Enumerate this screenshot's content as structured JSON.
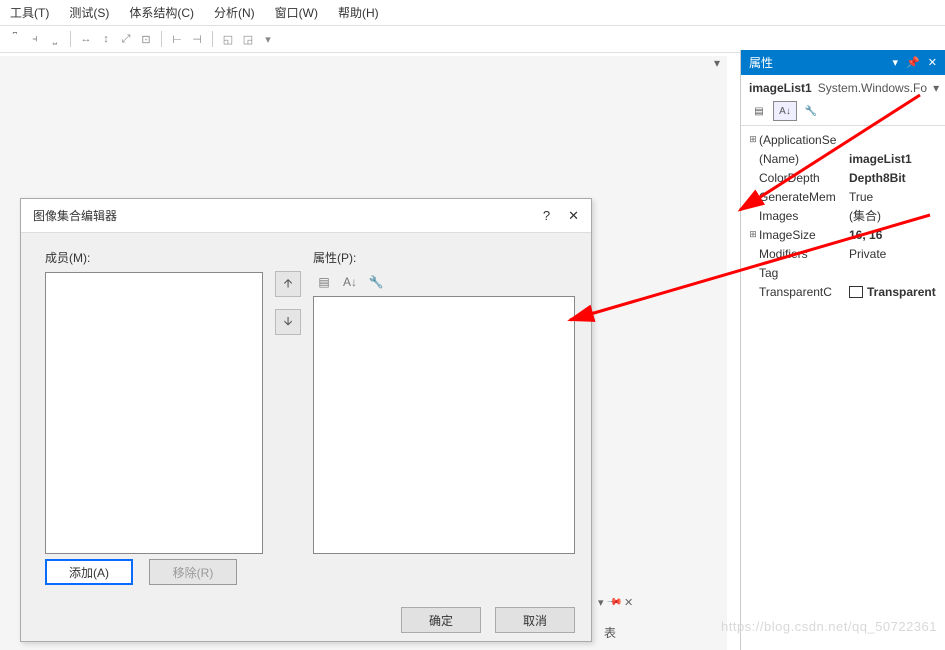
{
  "menu": {
    "tools": "工具(T)",
    "test": "测试(S)",
    "structure": "体系结构(C)",
    "analyze": "分析(N)",
    "window": "窗口(W)",
    "help": "帮助(H)"
  },
  "dialog": {
    "title": "图像集合编辑器",
    "members_label": "成员(M):",
    "props_label": "属性(P):",
    "add": "添加(A)",
    "remove": "移除(R)",
    "ok": "确定",
    "cancel": "取消",
    "help_icon": "?",
    "close_icon": "✕"
  },
  "panel": {
    "title": "属性",
    "object_name": "imageList1",
    "object_type": "System.Windows.Fo",
    "rows": {
      "app": "(ApplicationSe",
      "name_k": "(Name)",
      "name_v": "imageList1",
      "color_k": "ColorDepth",
      "color_v": "Depth8Bit",
      "gen_k": "GenerateMem",
      "gen_v": "True",
      "img_k": "Images",
      "img_v": "(集合)",
      "size_k": "ImageSize",
      "size_v": "16, 16",
      "mod_k": "Modifiers",
      "mod_v": "Private",
      "tag_k": "Tag",
      "trans_k": "TransparentC",
      "trans_v": "Transparent"
    }
  },
  "bottom_label": "表",
  "watermark": "https://blog.csdn.net/qq_50722361"
}
